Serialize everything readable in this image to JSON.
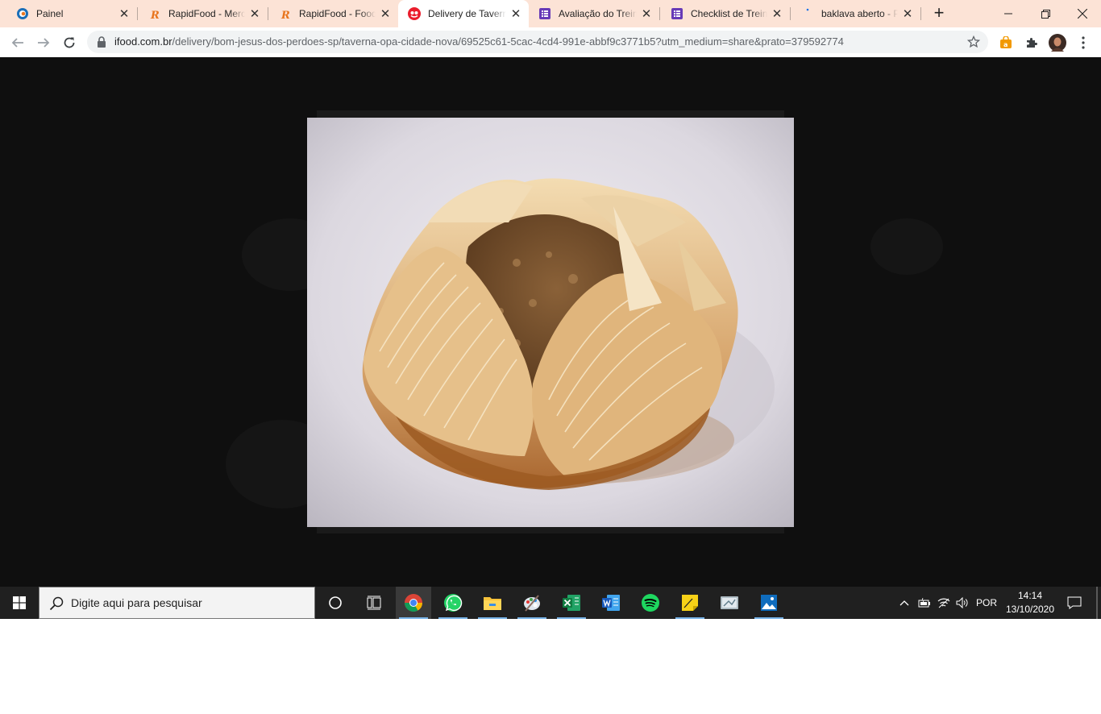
{
  "browser": {
    "tabs": [
      {
        "title": "Painel",
        "favicon": "painel-icon"
      },
      {
        "title": "RapidFood - Merch",
        "favicon": "rapidfood-icon"
      },
      {
        "title": "RapidFood - FoodM",
        "favicon": "rapidfood-icon"
      },
      {
        "title": "Delivery de Taverna",
        "favicon": "ifood-icon",
        "active": true
      },
      {
        "title": "Avaliação do Treina",
        "favicon": "forms-icon"
      },
      {
        "title": "Checklist de Treina",
        "favicon": "forms-icon"
      },
      {
        "title": "baklava aberto - Pe",
        "favicon": "loading-icon"
      }
    ],
    "address": {
      "host": "ifood.com.br",
      "path": "/delivery/bom-jesus-dos-perdoes-sp/taverna-opa-cidade-nova/69525c61-5cac-4cd4-991e-abbf9c3771b5?utm_medium=share&prato=379592774"
    }
  },
  "content": {
    "image_alt": "baklava aberto"
  },
  "taskbar": {
    "search_placeholder": "Digite aqui para pesquisar",
    "language": "POR",
    "time": "14:14",
    "date": "13/10/2020",
    "apps": [
      "chrome-icon",
      "whatsapp-icon",
      "file-explorer-icon",
      "paint-icon",
      "excel-icon",
      "word-icon",
      "spotify-icon",
      "sticky-notes-icon",
      "snipping-tool-icon",
      "photos-icon"
    ]
  },
  "colors": {
    "tabstrip": "#fce3d6",
    "content_bg": "#0f0f0f",
    "taskbar": "#202020",
    "accent_blue": "#78b4e8"
  }
}
